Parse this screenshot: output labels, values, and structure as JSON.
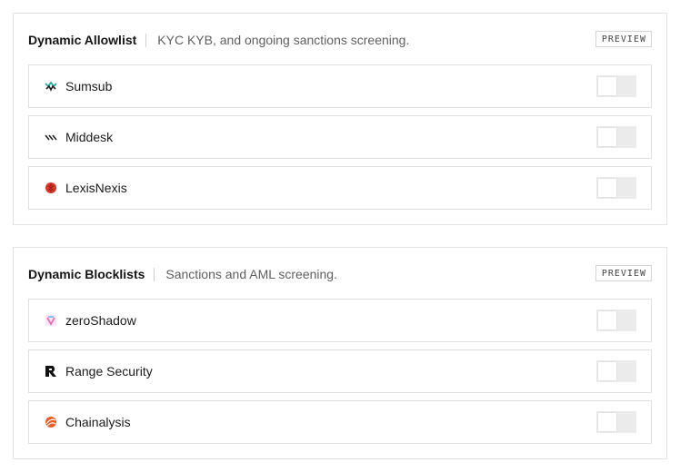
{
  "allowlist": {
    "title": "Dynamic Allowlist",
    "subtitle": "KYC KYB, and ongoing sanctions screening.",
    "badge": "PREVIEW",
    "items": [
      {
        "label": "Sumsub",
        "icon": "sumsub-icon",
        "enabled": false
      },
      {
        "label": "Middesk",
        "icon": "middesk-icon",
        "enabled": false
      },
      {
        "label": "LexisNexis",
        "icon": "lexisnexis-icon",
        "enabled": false
      }
    ]
  },
  "blocklist": {
    "title": "Dynamic Blocklists",
    "subtitle": "Sanctions and AML screening.",
    "badge": "PREVIEW",
    "items": [
      {
        "label": "zeroShadow",
        "icon": "zeroshadow-icon",
        "enabled": false
      },
      {
        "label": "Range Security",
        "icon": "range-security-icon",
        "enabled": false
      },
      {
        "label": "Chainalysis",
        "icon": "chainalysis-icon",
        "enabled": false
      }
    ]
  },
  "colors": {
    "toggle_off": "#ebebeb",
    "border": "#e3e3e3",
    "lexisnexis": "#d9352a",
    "chainalysis": "#f15a22",
    "sumsub": "#1aa7a0",
    "zeroshadow": "#e85fb8"
  }
}
